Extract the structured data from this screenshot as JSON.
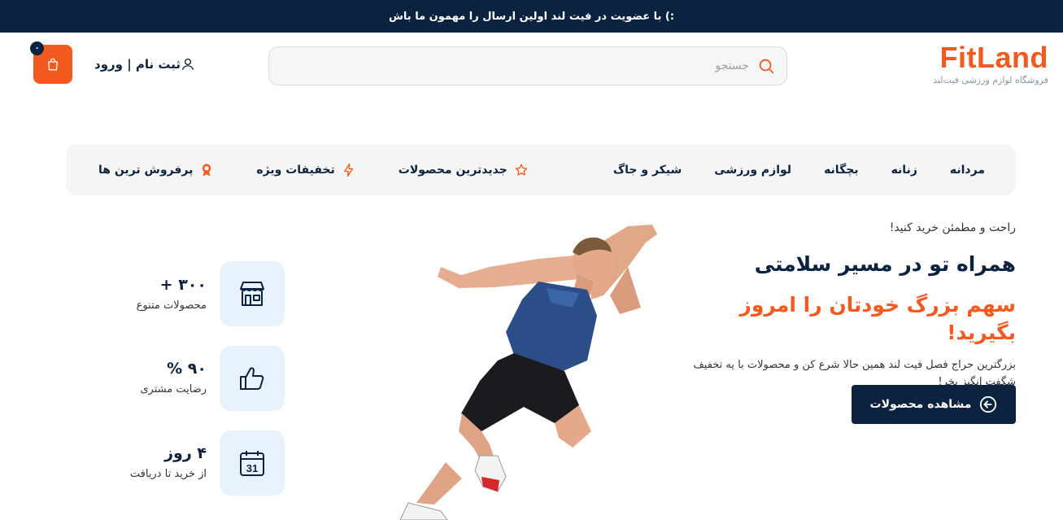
{
  "announcement": ":) با عضویت در فیت لند اولین ارسال را مهمون ما باش",
  "logo": {
    "brand": "FitLand",
    "tagline": "فروشگاه لوازم ورزشی فیت‌لند"
  },
  "search": {
    "placeholder": "جستجو"
  },
  "auth": {
    "label": "ثبت نام | ورود"
  },
  "cart": {
    "count": "۰"
  },
  "nav": {
    "categories": [
      "مردانه",
      "زنانه",
      "بچگانه",
      "لوازم ورزشی",
      "شیکر و جاگ"
    ],
    "promos": [
      {
        "label": "جدیدترین محصولات",
        "icon": "star-icon"
      },
      {
        "label": "تخفیفات ویژه",
        "icon": "lightning-icon"
      },
      {
        "label": "پرفروش ترین ها",
        "icon": "award-icon"
      }
    ]
  },
  "hero": {
    "kicker": "راحت و مطمئن خرید کنید!",
    "title": "همراه تو در مسیر سلامتی",
    "highlight": "سهم بزرگ خودتان را امروز بگیرید!",
    "description": "بزرگترین حراج فصل فیت لند همین حالا شرع کن و محصولات با یه تخفیف شگفت انگیز بخر!",
    "cta_label": "مشاهده محصولات"
  },
  "stats": [
    {
      "value": "۳۰۰ +",
      "label": "محصولات متنوع",
      "icon": "store-icon"
    },
    {
      "value": "۹۰ %",
      "label": "رضایت مشتری",
      "icon": "thumbs-up-icon"
    },
    {
      "value": "۴ روز",
      "label": "از خرید تا دریافت",
      "icon": "calendar-icon"
    }
  ],
  "calendar_day": "31",
  "colors": {
    "primary": "#0c2340",
    "accent": "#f25a1f",
    "soft_blue": "#e8f2fd",
    "nav_bg": "#f5f5f5"
  }
}
